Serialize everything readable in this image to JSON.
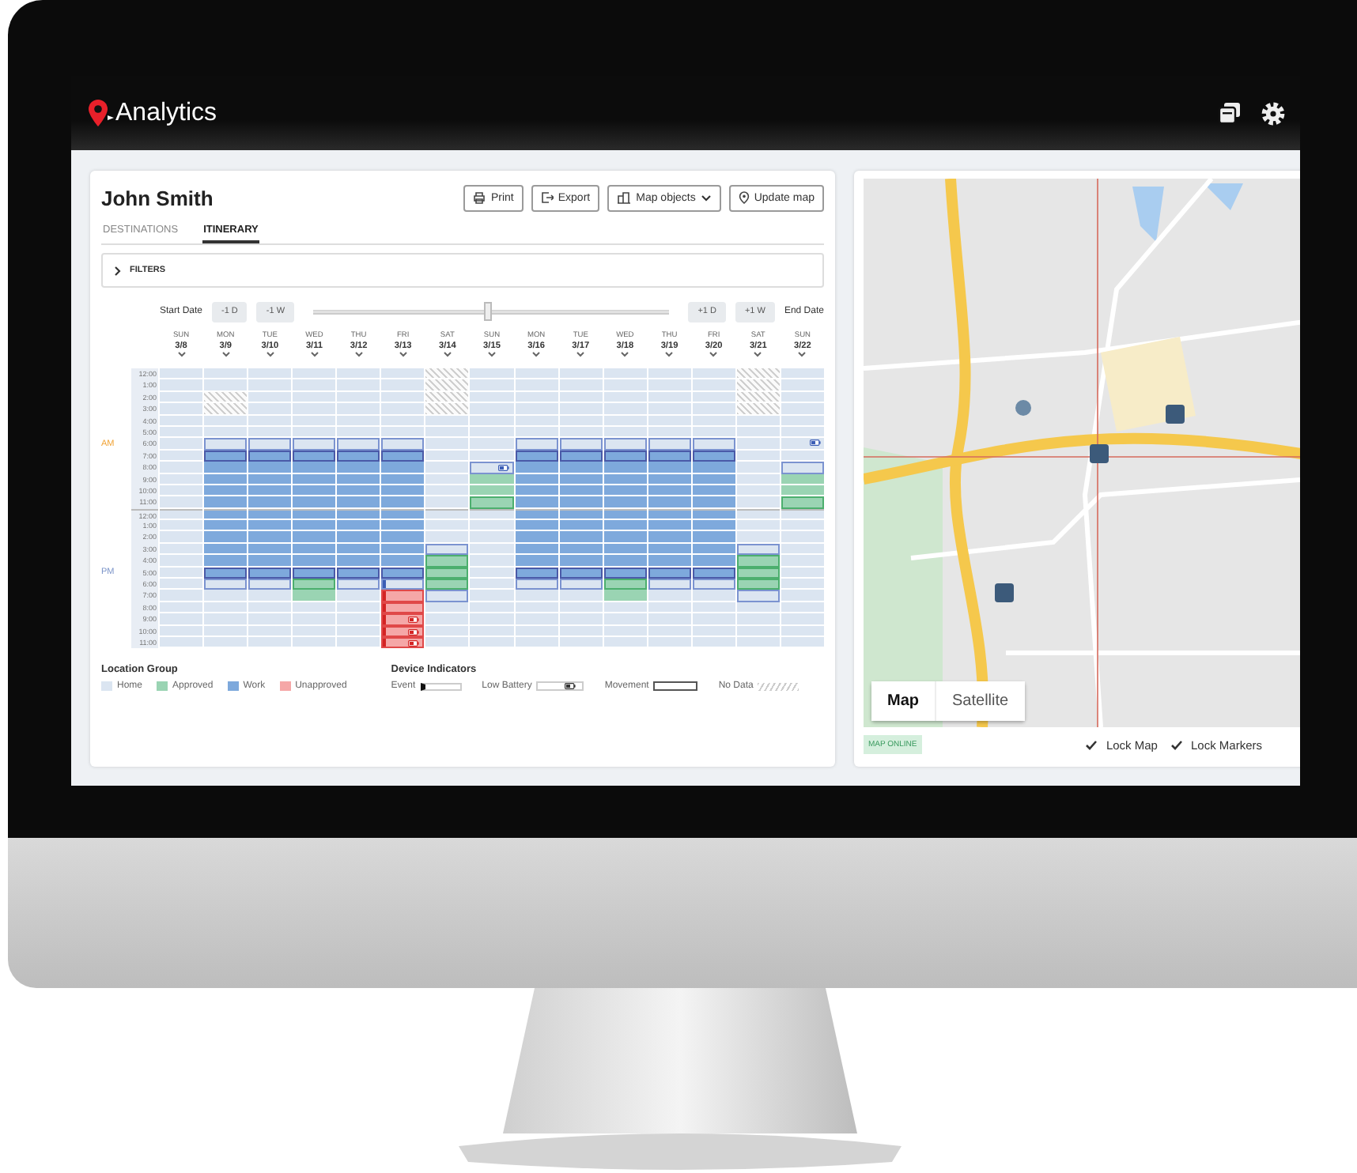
{
  "app": {
    "title": "Analytics"
  },
  "person": {
    "name": "John Smith"
  },
  "actions": [
    {
      "label": "Print",
      "dropdown": false
    },
    {
      "label": "Export",
      "dropdown": false
    },
    {
      "label": "Map objects",
      "dropdown": true
    },
    {
      "label": "Update map",
      "dropdown": false
    }
  ],
  "tabs": [
    {
      "label": "DESTINATIONS",
      "selected": false
    },
    {
      "label": "ITINERARY",
      "selected": true
    }
  ],
  "filters": {
    "label": "FILTERS",
    "expanded": false
  },
  "range": {
    "start_label": "Start Date",
    "end_label": "End Date",
    "back": [
      "-1 D",
      "-1 W"
    ],
    "forward": [
      "+1 D",
      "+1 W"
    ],
    "level": 0.49
  },
  "hours": {
    "am": "AM",
    "pm": "PM",
    "labels": [
      "12:00",
      "1:00",
      "2:00",
      "3:00",
      "4:00",
      "5:00",
      "6:00",
      "7:00",
      "8:00",
      "9:00",
      "10:00",
      "11:00",
      "12:00",
      "1:00",
      "2:00",
      "3:00",
      "4:00",
      "5:00",
      "6:00",
      "7:00",
      "8:00",
      "9:00",
      "10:00",
      "11:00"
    ]
  },
  "days": [
    {
      "weekday": "SUN",
      "date": "3/8",
      "cells": [
        {
          "kind": "home"
        },
        {
          "kind": "home"
        },
        {
          "kind": "home"
        },
        {
          "kind": "home"
        },
        {
          "kind": "home"
        },
        {
          "kind": "home"
        },
        {
          "kind": "home"
        },
        {
          "kind": "home"
        },
        {
          "kind": "home"
        },
        {
          "kind": "home"
        },
        {
          "kind": "home"
        },
        {
          "kind": "home"
        },
        {
          "kind": "home"
        },
        {
          "kind": "home"
        },
        {
          "kind": "home"
        },
        {
          "kind": "home"
        },
        {
          "kind": "home"
        },
        {
          "kind": "home"
        },
        {
          "kind": "home"
        },
        {
          "kind": "home"
        },
        {
          "kind": "home"
        },
        {
          "kind": "home"
        },
        {
          "kind": "home"
        },
        {
          "kind": "home"
        }
      ]
    },
    {
      "weekday": "MON",
      "date": "3/9",
      "cells": [
        {
          "kind": "home"
        },
        {
          "kind": "home"
        },
        {
          "kind": "nodata"
        },
        {
          "kind": "nodata"
        },
        {
          "kind": "home"
        },
        {
          "kind": "home"
        },
        {
          "kind": "homemove"
        },
        {
          "kind": "workmove"
        },
        {
          "kind": "work"
        },
        {
          "kind": "work"
        },
        {
          "kind": "work"
        },
        {
          "kind": "work"
        },
        {
          "kind": "work"
        },
        {
          "kind": "work"
        },
        {
          "kind": "work"
        },
        {
          "kind": "work"
        },
        {
          "kind": "work"
        },
        {
          "kind": "workmove"
        },
        {
          "kind": "homemove"
        },
        {
          "kind": "home"
        },
        {
          "kind": "home"
        },
        {
          "kind": "home"
        },
        {
          "kind": "home"
        },
        {
          "kind": "home"
        }
      ]
    },
    {
      "weekday": "TUE",
      "date": "3/10",
      "cells": [
        {
          "kind": "home"
        },
        {
          "kind": "home"
        },
        {
          "kind": "home"
        },
        {
          "kind": "home"
        },
        {
          "kind": "home"
        },
        {
          "kind": "home"
        },
        {
          "kind": "homemove"
        },
        {
          "kind": "workmove"
        },
        {
          "kind": "work"
        },
        {
          "kind": "work"
        },
        {
          "kind": "work"
        },
        {
          "kind": "work"
        },
        {
          "kind": "work"
        },
        {
          "kind": "work"
        },
        {
          "kind": "work"
        },
        {
          "kind": "work"
        },
        {
          "kind": "work"
        },
        {
          "kind": "workmove"
        },
        {
          "kind": "homemove"
        },
        {
          "kind": "home"
        },
        {
          "kind": "home"
        },
        {
          "kind": "home"
        },
        {
          "kind": "home"
        },
        {
          "kind": "home"
        }
      ]
    },
    {
      "weekday": "WED",
      "date": "3/11",
      "cells": [
        {
          "kind": "home"
        },
        {
          "kind": "home"
        },
        {
          "kind": "home"
        },
        {
          "kind": "home"
        },
        {
          "kind": "home"
        },
        {
          "kind": "home"
        },
        {
          "kind": "homemove"
        },
        {
          "kind": "workmove"
        },
        {
          "kind": "work"
        },
        {
          "kind": "work"
        },
        {
          "kind": "work"
        },
        {
          "kind": "work"
        },
        {
          "kind": "work"
        },
        {
          "kind": "work"
        },
        {
          "kind": "work"
        },
        {
          "kind": "work"
        },
        {
          "kind": "work"
        },
        {
          "kind": "workmove"
        },
        {
          "kind": "approvedmove"
        },
        {
          "kind": "approved"
        },
        {
          "kind": "home"
        },
        {
          "kind": "home"
        },
        {
          "kind": "home"
        },
        {
          "kind": "home"
        }
      ]
    },
    {
      "weekday": "THU",
      "date": "3/12",
      "cells": [
        {
          "kind": "home"
        },
        {
          "kind": "home"
        },
        {
          "kind": "home"
        },
        {
          "kind": "home"
        },
        {
          "kind": "home"
        },
        {
          "kind": "home"
        },
        {
          "kind": "homemove"
        },
        {
          "kind": "workmove"
        },
        {
          "kind": "work"
        },
        {
          "kind": "work"
        },
        {
          "kind": "work"
        },
        {
          "kind": "work"
        },
        {
          "kind": "work"
        },
        {
          "kind": "work"
        },
        {
          "kind": "work"
        },
        {
          "kind": "work"
        },
        {
          "kind": "work"
        },
        {
          "kind": "workmove"
        },
        {
          "kind": "homemove"
        },
        {
          "kind": "home"
        },
        {
          "kind": "home"
        },
        {
          "kind": "home"
        },
        {
          "kind": "home"
        },
        {
          "kind": "home"
        }
      ]
    },
    {
      "weekday": "FRI",
      "date": "3/13",
      "cells": [
        {
          "kind": "home"
        },
        {
          "kind": "home"
        },
        {
          "kind": "home"
        },
        {
          "kind": "home"
        },
        {
          "kind": "home"
        },
        {
          "kind": "home"
        },
        {
          "kind": "homemove"
        },
        {
          "kind": "workmove"
        },
        {
          "kind": "work"
        },
        {
          "kind": "work"
        },
        {
          "kind": "work"
        },
        {
          "kind": "work"
        },
        {
          "kind": "work"
        },
        {
          "kind": "work"
        },
        {
          "kind": "work"
        },
        {
          "kind": "work"
        },
        {
          "kind": "work"
        },
        {
          "kind": "workmove"
        },
        {
          "kind": "homemoveevent"
        },
        {
          "kind": "unapprovedmoveevent"
        },
        {
          "kind": "unapprovedmoveevent"
        },
        {
          "kind": "unapprovedmoveeventbattery"
        },
        {
          "kind": "unapprovedmoveeventbattery"
        },
        {
          "kind": "unapprovedmoveeventbattery"
        }
      ]
    },
    {
      "weekday": "SAT",
      "date": "3/14",
      "cells": [
        {
          "kind": "nodata"
        },
        {
          "kind": "nodata"
        },
        {
          "kind": "nodata"
        },
        {
          "kind": "nodata"
        },
        {
          "kind": "home"
        },
        {
          "kind": "home"
        },
        {
          "kind": "home"
        },
        {
          "kind": "home"
        },
        {
          "kind": "home"
        },
        {
          "kind": "home"
        },
        {
          "kind": "home"
        },
        {
          "kind": "home"
        },
        {
          "kind": "home"
        },
        {
          "kind": "home"
        },
        {
          "kind": "home"
        },
        {
          "kind": "homemove"
        },
        {
          "kind": "approvedmove"
        },
        {
          "kind": "approvedmove"
        },
        {
          "kind": "approvedmove"
        },
        {
          "kind": "homemove"
        },
        {
          "kind": "home"
        },
        {
          "kind": "home"
        },
        {
          "kind": "home"
        },
        {
          "kind": "home"
        }
      ]
    },
    {
      "weekday": "SUN",
      "date": "3/15",
      "cells": [
        {
          "kind": "home"
        },
        {
          "kind": "home"
        },
        {
          "kind": "home"
        },
        {
          "kind": "home"
        },
        {
          "kind": "home"
        },
        {
          "kind": "home"
        },
        {
          "kind": "home"
        },
        {
          "kind": "home"
        },
        {
          "kind": "homemovebattery"
        },
        {
          "kind": "approved"
        },
        {
          "kind": "approved"
        },
        {
          "kind": "approvedmove"
        },
        {
          "kind": "home"
        },
        {
          "kind": "home"
        },
        {
          "kind": "home"
        },
        {
          "kind": "home"
        },
        {
          "kind": "home"
        },
        {
          "kind": "home"
        },
        {
          "kind": "home"
        },
        {
          "kind": "home"
        },
        {
          "kind": "home"
        },
        {
          "kind": "home"
        },
        {
          "kind": "home"
        },
        {
          "kind": "home"
        }
      ]
    },
    {
      "weekday": "MON",
      "date": "3/16",
      "cells": [
        {
          "kind": "home"
        },
        {
          "kind": "home"
        },
        {
          "kind": "home"
        },
        {
          "kind": "home"
        },
        {
          "kind": "home"
        },
        {
          "kind": "home"
        },
        {
          "kind": "homemove"
        },
        {
          "kind": "workmove"
        },
        {
          "kind": "work"
        },
        {
          "kind": "work"
        },
        {
          "kind": "work"
        },
        {
          "kind": "work"
        },
        {
          "kind": "work"
        },
        {
          "kind": "work"
        },
        {
          "kind": "work"
        },
        {
          "kind": "work"
        },
        {
          "kind": "work"
        },
        {
          "kind": "workmove"
        },
        {
          "kind": "homemove"
        },
        {
          "kind": "home"
        },
        {
          "kind": "home"
        },
        {
          "kind": "home"
        },
        {
          "kind": "home"
        },
        {
          "kind": "home"
        }
      ]
    },
    {
      "weekday": "TUE",
      "date": "3/17",
      "cells": [
        {
          "kind": "home"
        },
        {
          "kind": "home"
        },
        {
          "kind": "home"
        },
        {
          "kind": "home"
        },
        {
          "kind": "home"
        },
        {
          "kind": "home"
        },
        {
          "kind": "homemove"
        },
        {
          "kind": "workmove"
        },
        {
          "kind": "work"
        },
        {
          "kind": "work"
        },
        {
          "kind": "work"
        },
        {
          "kind": "work"
        },
        {
          "kind": "work"
        },
        {
          "kind": "work"
        },
        {
          "kind": "work"
        },
        {
          "kind": "work"
        },
        {
          "kind": "work"
        },
        {
          "kind": "workmove"
        },
        {
          "kind": "homemove"
        },
        {
          "kind": "home"
        },
        {
          "kind": "home"
        },
        {
          "kind": "home"
        },
        {
          "kind": "home"
        },
        {
          "kind": "home"
        }
      ]
    },
    {
      "weekday": "WED",
      "date": "3/18",
      "cells": [
        {
          "kind": "home"
        },
        {
          "kind": "home"
        },
        {
          "kind": "home"
        },
        {
          "kind": "home"
        },
        {
          "kind": "home"
        },
        {
          "kind": "home"
        },
        {
          "kind": "homemove"
        },
        {
          "kind": "workmove"
        },
        {
          "kind": "work"
        },
        {
          "kind": "work"
        },
        {
          "kind": "work"
        },
        {
          "kind": "work"
        },
        {
          "kind": "work"
        },
        {
          "kind": "work"
        },
        {
          "kind": "work"
        },
        {
          "kind": "work"
        },
        {
          "kind": "work"
        },
        {
          "kind": "workmove"
        },
        {
          "kind": "approvedmove"
        },
        {
          "kind": "approved"
        },
        {
          "kind": "home"
        },
        {
          "kind": "home"
        },
        {
          "kind": "home"
        },
        {
          "kind": "home"
        }
      ]
    },
    {
      "weekday": "THU",
      "date": "3/19",
      "cells": [
        {
          "kind": "home"
        },
        {
          "kind": "home"
        },
        {
          "kind": "home"
        },
        {
          "kind": "home"
        },
        {
          "kind": "home"
        },
        {
          "kind": "home"
        },
        {
          "kind": "homemove"
        },
        {
          "kind": "workmove"
        },
        {
          "kind": "work"
        },
        {
          "kind": "work"
        },
        {
          "kind": "work"
        },
        {
          "kind": "work"
        },
        {
          "kind": "work"
        },
        {
          "kind": "work"
        },
        {
          "kind": "work"
        },
        {
          "kind": "work"
        },
        {
          "kind": "work"
        },
        {
          "kind": "workmove"
        },
        {
          "kind": "homemove"
        },
        {
          "kind": "home"
        },
        {
          "kind": "home"
        },
        {
          "kind": "home"
        },
        {
          "kind": "home"
        },
        {
          "kind": "home"
        }
      ]
    },
    {
      "weekday": "FRI",
      "date": "3/20",
      "cells": [
        {
          "kind": "home"
        },
        {
          "kind": "home"
        },
        {
          "kind": "home"
        },
        {
          "kind": "home"
        },
        {
          "kind": "home"
        },
        {
          "kind": "home"
        },
        {
          "kind": "homemove"
        },
        {
          "kind": "workmove"
        },
        {
          "kind": "work"
        },
        {
          "kind": "work"
        },
        {
          "kind": "work"
        },
        {
          "kind": "work"
        },
        {
          "kind": "work"
        },
        {
          "kind": "work"
        },
        {
          "kind": "work"
        },
        {
          "kind": "work"
        },
        {
          "kind": "work"
        },
        {
          "kind": "workmove"
        },
        {
          "kind": "homemove"
        },
        {
          "kind": "home"
        },
        {
          "kind": "home"
        },
        {
          "kind": "home"
        },
        {
          "kind": "home"
        },
        {
          "kind": "home"
        }
      ]
    },
    {
      "weekday": "SAT",
      "date": "3/21",
      "cells": [
        {
          "kind": "nodata"
        },
        {
          "kind": "nodata"
        },
        {
          "kind": "nodata"
        },
        {
          "kind": "nodata"
        },
        {
          "kind": "home"
        },
        {
          "kind": "home"
        },
        {
          "kind": "home"
        },
        {
          "kind": "home"
        },
        {
          "kind": "home"
        },
        {
          "kind": "home"
        },
        {
          "kind": "home"
        },
        {
          "kind": "home"
        },
        {
          "kind": "home"
        },
        {
          "kind": "home"
        },
        {
          "kind": "home"
        },
        {
          "kind": "homemove"
        },
        {
          "kind": "approvedmove"
        },
        {
          "kind": "approvedmove"
        },
        {
          "kind": "approvedmove"
        },
        {
          "kind": "homemove"
        },
        {
          "kind": "home"
        },
        {
          "kind": "home"
        },
        {
          "kind": "home"
        },
        {
          "kind": "home"
        }
      ]
    },
    {
      "weekday": "SUN",
      "date": "3/22",
      "cells": [
        {
          "kind": "home"
        },
        {
          "kind": "home"
        },
        {
          "kind": "home"
        },
        {
          "kind": "home"
        },
        {
          "kind": "home"
        },
        {
          "kind": "home"
        },
        {
          "kind": "homebattery"
        },
        {
          "kind": "home"
        },
        {
          "kind": "homemove"
        },
        {
          "kind": "approved"
        },
        {
          "kind": "approved"
        },
        {
          "kind": "approvedmove"
        },
        {
          "kind": "home"
        },
        {
          "kind": "home"
        },
        {
          "kind": "home"
        },
        {
          "kind": "home"
        },
        {
          "kind": "home"
        },
        {
          "kind": "home"
        },
        {
          "kind": "home"
        },
        {
          "kind": "home"
        },
        {
          "kind": "home"
        },
        {
          "kind": "home"
        },
        {
          "kind": "home"
        },
        {
          "kind": "home"
        }
      ]
    }
  ],
  "legend": {
    "location_title": "Location Group",
    "locations": [
      {
        "label": "Home",
        "color": "#dbe5f1"
      },
      {
        "label": "Approved",
        "color": "#9ad4b3"
      },
      {
        "label": "Work",
        "color": "#7ea9dc"
      },
      {
        "label": "Unapproved",
        "color": "#f5a7a7"
      }
    ],
    "device_title": "Device Indicators",
    "devices": [
      {
        "label": "Event",
        "kind": "event"
      },
      {
        "label": "Low Battery",
        "kind": "battery"
      },
      {
        "label": "Movement",
        "kind": "movement"
      },
      {
        "label": "No Data",
        "kind": "nodata"
      }
    ]
  },
  "map": {
    "modes": [
      {
        "label": "Map",
        "selected": true
      },
      {
        "label": "Satellite",
        "selected": false
      }
    ],
    "status": "MAP ONLINE",
    "options": [
      {
        "label": "Lock Map",
        "checked": true
      },
      {
        "label": "Lock Markers",
        "checked": true
      }
    ]
  }
}
